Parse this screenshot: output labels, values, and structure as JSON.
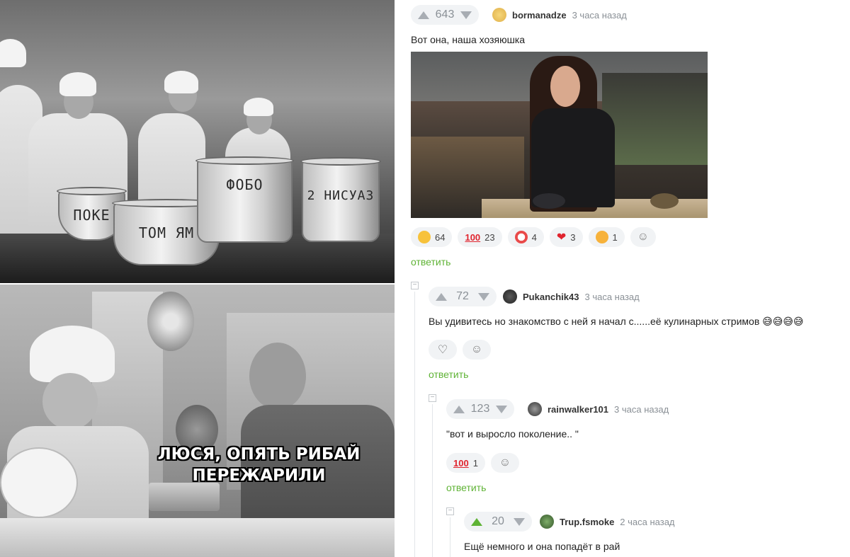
{
  "meme": {
    "pot_labels": [
      "ПОКЕ",
      "ТОМ ЯМ",
      "ФОБО",
      "2 НИСУАЗ"
    ],
    "caption_line1": "ЛЮСЯ, ОПЯТЬ РИБАЙ",
    "caption_line2": "ПЕРЕЖАРИЛИ"
  },
  "comments": [
    {
      "score": "643",
      "author": "bormanadze",
      "time": "3 часа назад",
      "text": "Вот она, наша хозяюшка",
      "reactions": [
        {
          "icon": "laughing-emoji-icon",
          "count": "64"
        },
        {
          "icon": "hundred-emoji-icon",
          "count": "23"
        },
        {
          "icon": "clown-emoji-icon",
          "count": "4"
        },
        {
          "icon": "heart-icon",
          "count": "3"
        },
        {
          "icon": "kiss-emoji-icon",
          "count": "1"
        }
      ],
      "reply_label": "ответить"
    },
    {
      "score": "72",
      "author": "Pukanchik43",
      "time": "3 часа назад",
      "text": "Вы удивитесь но знакомство с ней я начал с......её кулинарных стримов 😅😅😅😅",
      "reply_label": "ответить"
    },
    {
      "score": "123",
      "author": "rainwalker101",
      "time": "3 часа назад",
      "text": "\"вот и выросло поколение.. \"",
      "reactions": [
        {
          "icon": "hundred-emoji-icon",
          "count": "1"
        }
      ],
      "reply_label": "ответить"
    },
    {
      "score": "20",
      "author": "Trup.fsmoke",
      "time": "2 часа назад",
      "text": "Ещё немного и она попадёт в рай"
    }
  ],
  "colors": {
    "accent_green": "#5fb335",
    "muted": "#8a9096",
    "pill_bg": "#f1f3f5"
  }
}
